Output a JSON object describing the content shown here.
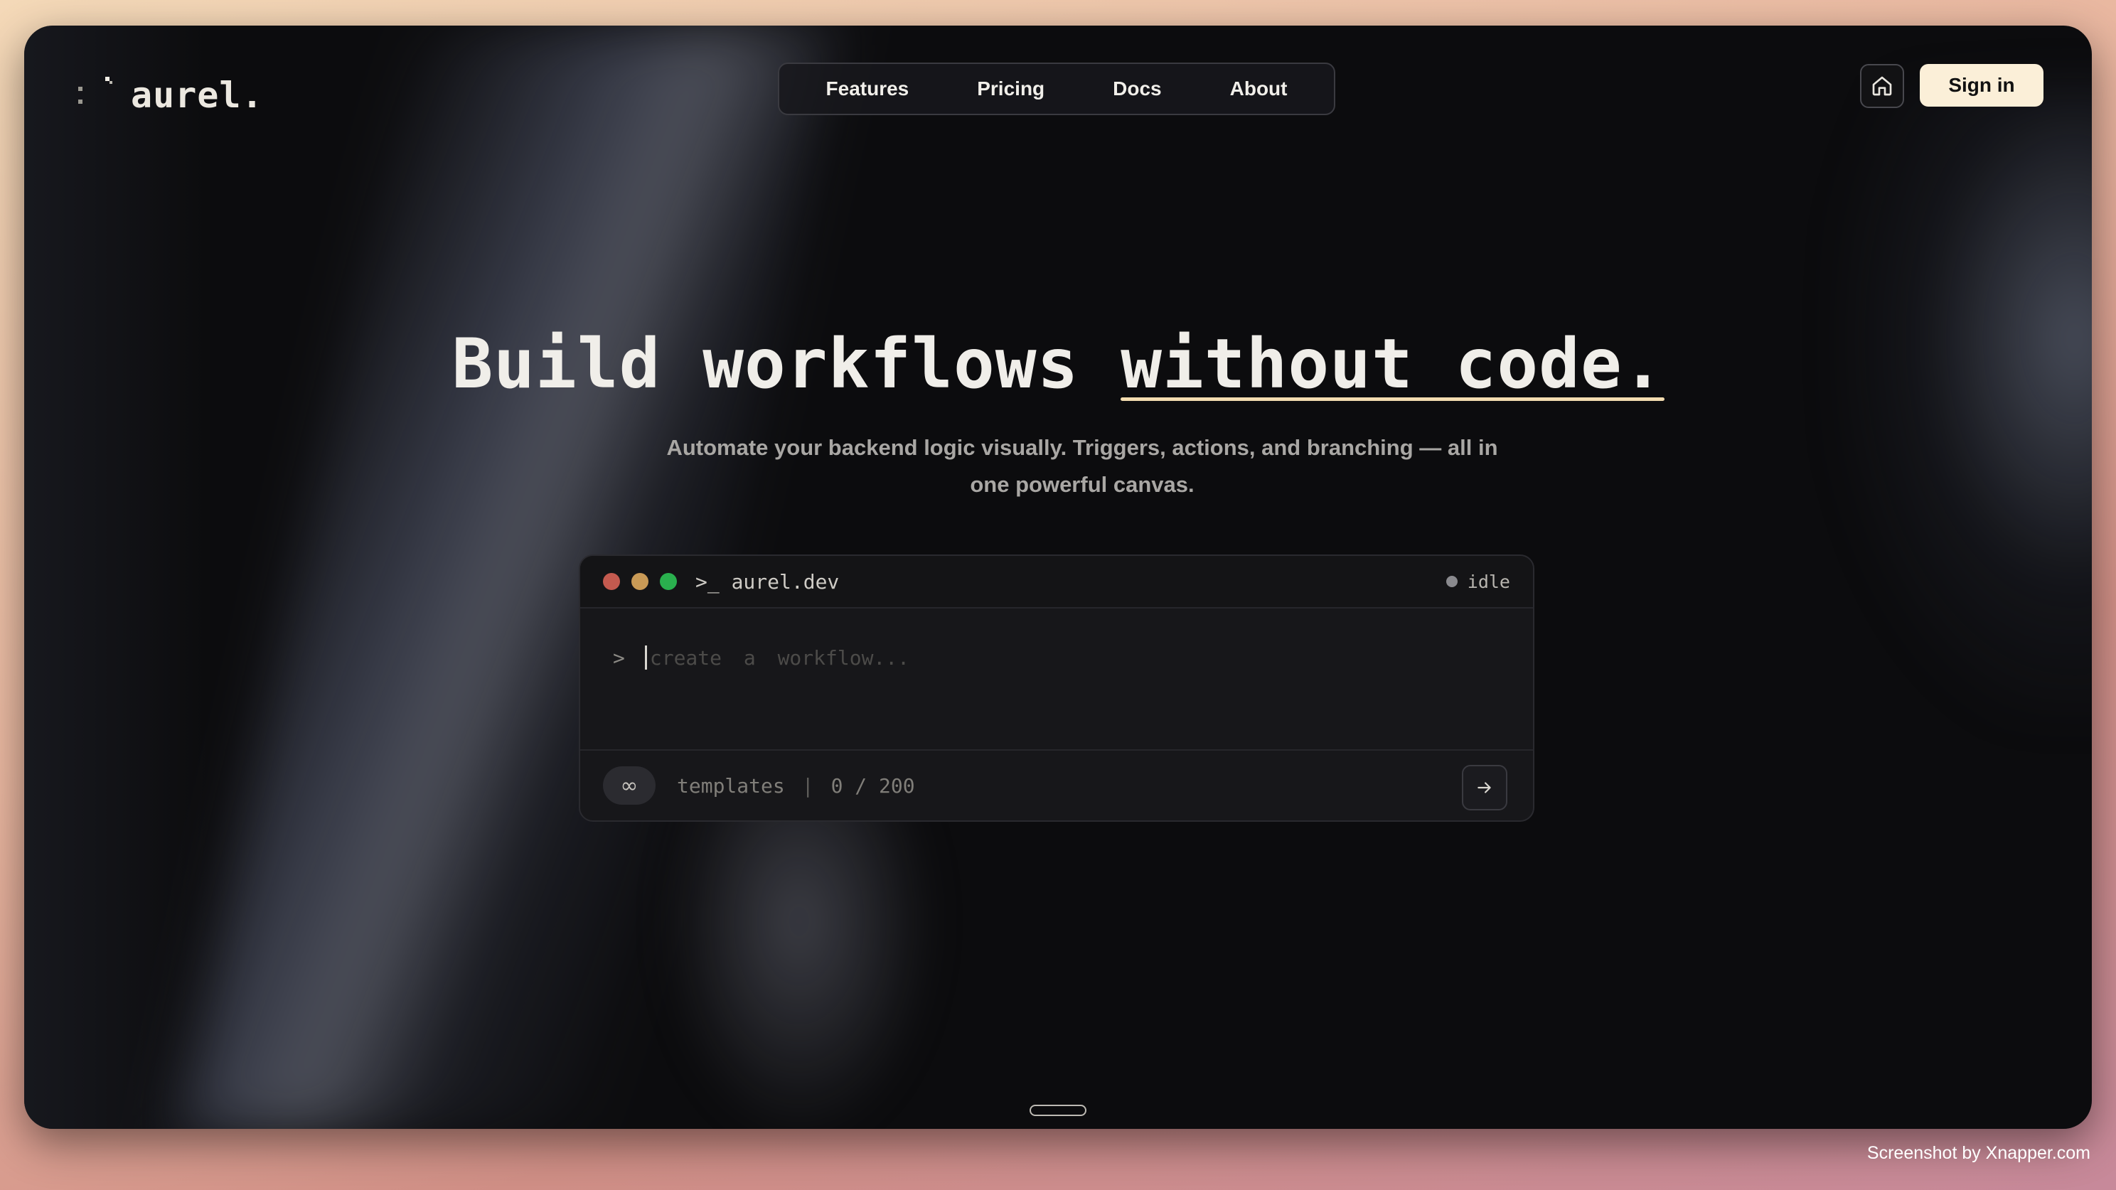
{
  "brand": {
    "name": "aurel."
  },
  "nav": {
    "items": [
      {
        "label": "Features"
      },
      {
        "label": "Pricing"
      },
      {
        "label": "Docs"
      },
      {
        "label": "About"
      }
    ]
  },
  "header": {
    "signin_label": "Sign in",
    "home_icon": "home-icon"
  },
  "hero": {
    "title_main": "Build workflows ",
    "title_accent": "without code.",
    "subtitle": "Automate your backend logic visually. Triggers, actions, and branching — all in one powerful canvas."
  },
  "terminal": {
    "title": ">_ aurel.dev",
    "status": "idle",
    "prompt": ">",
    "placeholder": "create a workflow...",
    "infinity": "∞",
    "templates_label": "templates",
    "separator": "|",
    "counter": "0 / 200",
    "send_icon": "arrow-right-icon"
  },
  "credit": "Screenshot by Xnapper.com",
  "colors": {
    "accent": "#fbefd8",
    "background": "#0c0c0e",
    "dot_red": "#c45a4f",
    "dot_yellow": "#c99a56",
    "dot_green": "#2ab04e"
  }
}
